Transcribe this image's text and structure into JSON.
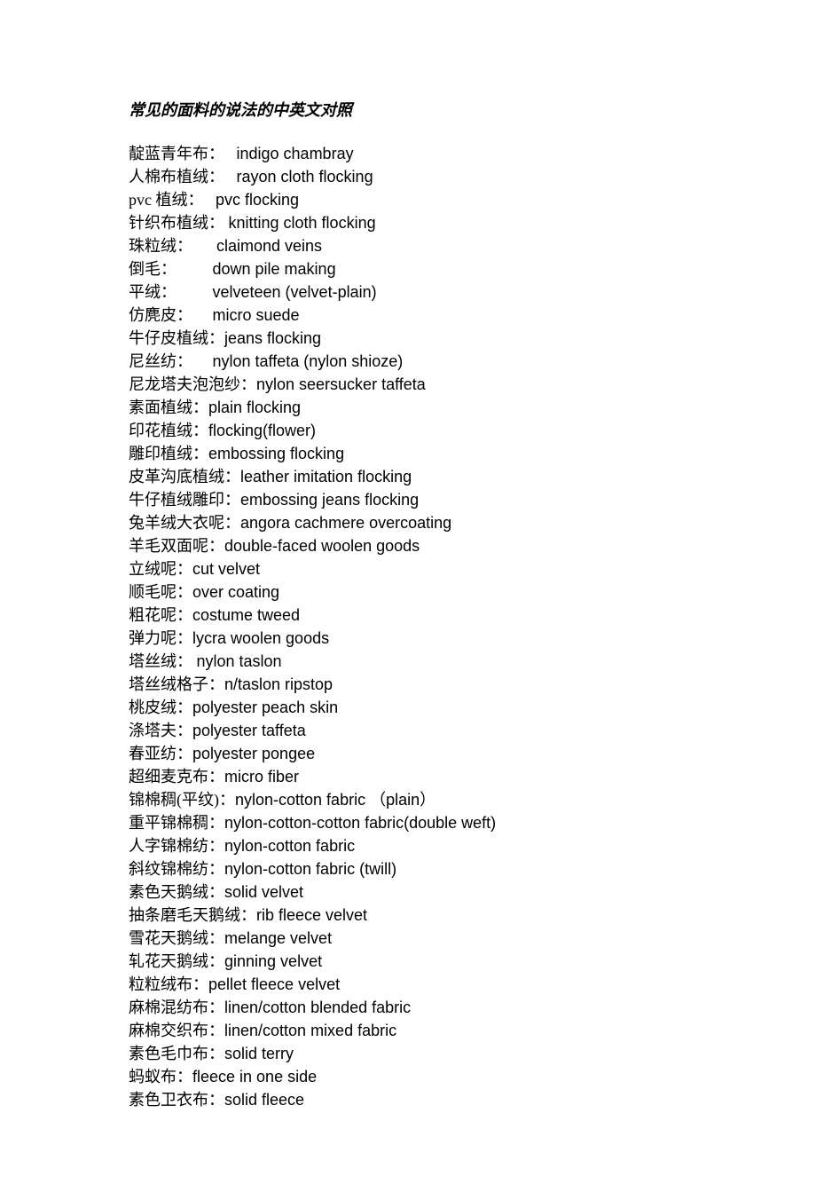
{
  "title": "常见的面料的说法的中英文对照",
  "entries": [
    {
      "cn": "靛蓝青年布：   ",
      "en": "indigo chambray"
    },
    {
      "cn": "人棉布植绒：   ",
      "en": "rayon cloth flocking"
    },
    {
      "cn": "pvc 植绒：   ",
      "en": "pvc flocking"
    },
    {
      "cn": "针织布植绒： ",
      "en": "knitting cloth flocking"
    },
    {
      "cn": "珠粒绒：      ",
      "en": "claimond veins"
    },
    {
      "cn": "倒毛：         ",
      "en": "down pile making"
    },
    {
      "cn": "平绒：         ",
      "en": "velveteen (velvet-plain)"
    },
    {
      "cn": "仿麂皮：     ",
      "en": "micro suede"
    },
    {
      "cn": "牛仔皮植绒：",
      "en": "jeans flocking"
    },
    {
      "cn": "尼丝纺：     ",
      "en": "nylon taffeta (nylon shioze)"
    },
    {
      "cn": "尼龙塔夫泡泡纱：",
      "en": "nylon seersucker taffeta"
    },
    {
      "cn": "素面植绒：",
      "en": "plain flocking"
    },
    {
      "cn": "印花植绒：",
      "en": "flocking(flower)"
    },
    {
      "cn": "雕印植绒：",
      "en": "embossing flocking"
    },
    {
      "cn": "皮革沟底植绒：",
      "en": "leather imitation flocking"
    },
    {
      "cn": "牛仔植绒雕印：",
      "en": "embossing jeans flocking"
    },
    {
      "cn": "兔羊绒大衣呢：",
      "en": "angora cachmere overcoating"
    },
    {
      "cn": "羊毛双面呢：",
      "en": "double-faced woolen goods"
    },
    {
      "cn": "立绒呢：",
      "en": "cut velvet"
    },
    {
      "cn": "顺毛呢：",
      "en": "over coating"
    },
    {
      "cn": "粗花呢：",
      "en": "costume tweed"
    },
    {
      "cn": "弹力呢：",
      "en": "lycra woolen goods"
    },
    {
      "cn": "塔丝绒： ",
      "en": "nylon taslon"
    },
    {
      "cn": "塔丝绒格子：",
      "en": "n/taslon ripstop"
    },
    {
      "cn": "桃皮绒：",
      "en": "polyester peach skin"
    },
    {
      "cn": "涤塔夫：",
      "en": "polyester taffeta"
    },
    {
      "cn": "春亚纺：",
      "en": "polyester pongee"
    },
    {
      "cn": "超细麦克布：",
      "en": "micro fiber"
    },
    {
      "cn": "锦棉稠(平纹)：",
      "en": "nylon-cotton fabric （plain）"
    },
    {
      "cn": "重平锦棉稠：",
      "en": "nylon-cotton-cotton fabric(double weft)"
    },
    {
      "cn": "人字锦棉纺：",
      "en": "nylon-cotton fabric"
    },
    {
      "cn": "斜纹锦棉纺：",
      "en": "nylon-cotton fabric (twill)"
    },
    {
      "cn": "素色天鹅绒：",
      "en": "solid velvet"
    },
    {
      "cn": "抽条磨毛天鹅绒：",
      "en": "rib fleece velvet"
    },
    {
      "cn": "雪花天鹅绒：",
      "en": "melange velvet"
    },
    {
      "cn": "轧花天鹅绒：",
      "en": "ginning velvet"
    },
    {
      "cn": "粒粒绒布：",
      "en": "pellet fleece velvet"
    },
    {
      "cn": "麻棉混纺布：",
      "en": "linen/cotton blended fabric"
    },
    {
      "cn": "麻棉交织布：",
      "en": "linen/cotton mixed fabric"
    },
    {
      "cn": "素色毛巾布：",
      "en": "solid terry"
    },
    {
      "cn": "蚂蚁布：",
      "en": "fleece in one side"
    },
    {
      "cn": "素色卫衣布：",
      "en": "solid fleece"
    }
  ]
}
